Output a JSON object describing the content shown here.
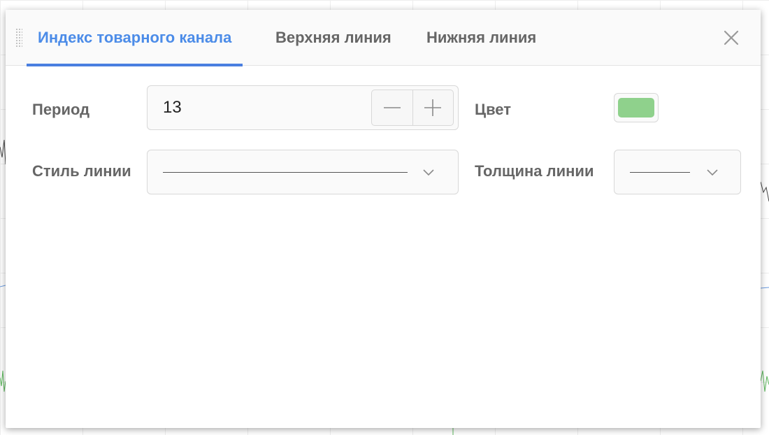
{
  "tabs": [
    {
      "label": "Индекс товарного канала",
      "active": true
    },
    {
      "label": "Верхняя линия",
      "active": false
    },
    {
      "label": "Нижняя линия",
      "active": false
    }
  ],
  "icons": {
    "close": "close-icon",
    "drag": "drag-handle-icon",
    "minus": "minus-icon",
    "plus": "plus-icon",
    "dropdown": "chevron-down-icon"
  },
  "form": {
    "period_label": "Период",
    "period_value": "13",
    "color_label": "Цвет",
    "color_value": "#8fd18c",
    "line_style_label": "Стиль линии",
    "line_width_label": "Толщина линии"
  },
  "colors": {
    "accent": "#4c8ce8",
    "label_text": "#666666",
    "series_color": "#8fd18c"
  }
}
